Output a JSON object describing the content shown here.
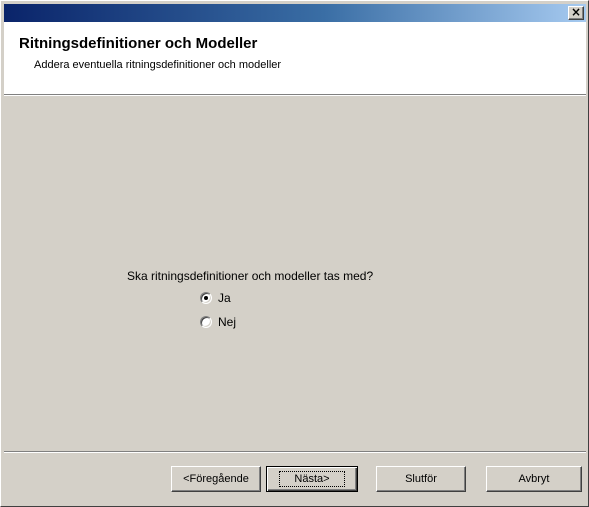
{
  "window": {
    "close_glyph": "×"
  },
  "header": {
    "title": "Ritningsdefinitioner och Modeller",
    "subtitle": "Addera eventuella ritningsdefinitioner och modeller"
  },
  "content": {
    "question": "Ska ritningsdefinitioner och modeller tas med?",
    "options": [
      {
        "label": "Ja",
        "selected": true
      },
      {
        "label": "Nej",
        "selected": false
      }
    ]
  },
  "buttons": {
    "back": "<Föregående",
    "next": "Nästa>",
    "finish": "Slutför",
    "cancel": "Avbryt"
  },
  "colors": {
    "dialog_face": "#d4d0c8",
    "titlebar_start": "#0a246a",
    "titlebar_end": "#a6caf0",
    "header_bg": "#ffffff"
  }
}
